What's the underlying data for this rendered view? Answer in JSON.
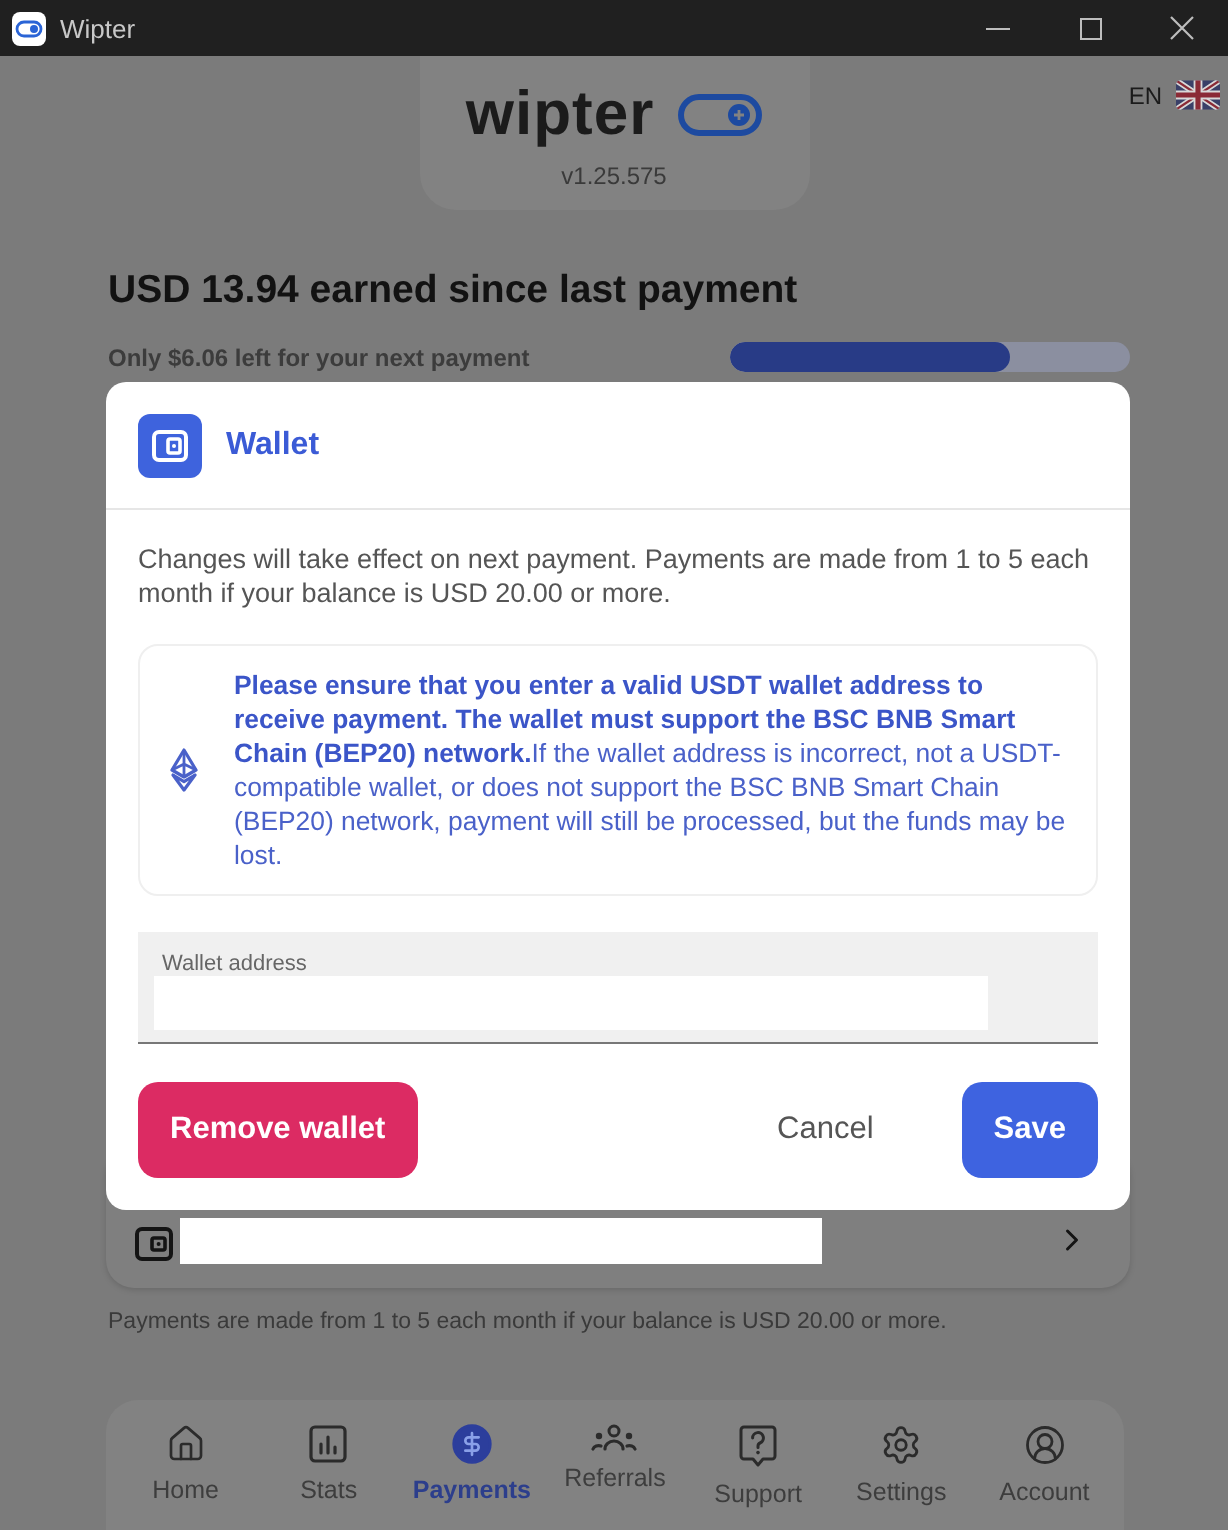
{
  "window": {
    "title": "Wipter"
  },
  "header": {
    "logo": "wipter",
    "version": "v1.25.575",
    "language": "EN"
  },
  "earnings": {
    "title": "USD 13.94 earned since last payment",
    "remaining": "Only $6.06 left for your next payment",
    "level": 0.7
  },
  "dialog": {
    "title": "Wallet",
    "notice": "Changes will take effect on next payment. Payments are made from 1 to 5 each month if your balance is USD 20.00 or more.",
    "warning": "**Please ensure that you enter a valid USDT wallet address to receive payment. The wallet must support the BSC BNB Smart Chain (BEP20) network.**If the wallet address is incorrect, not a USDT-compatible wallet, or does not support the BSC BNB Smart Chain (BEP20) network, payment will still be processed, but the funds may be lost.",
    "field": {
      "label": "Wallet address"
    },
    "buttons": [
      {
        "label": "Remove wallet",
        "kind": "danger"
      },
      {
        "label": "Cancel",
        "kind": "text"
      },
      {
        "label": "Save",
        "kind": "primary"
      }
    ]
  },
  "footnote": "Payments are made from 1 to 5 each month if your balance is USD 20.00 or more.",
  "nav": [
    {
      "label": "Home",
      "selected": false
    },
    {
      "label": "Stats",
      "selected": false
    },
    {
      "label": "Payments",
      "selected": true
    },
    {
      "label": "Referrals",
      "selected": false
    },
    {
      "label": "Support",
      "selected": false
    },
    {
      "label": "Settings",
      "selected": false
    },
    {
      "label": "Account",
      "selected": false
    }
  ]
}
